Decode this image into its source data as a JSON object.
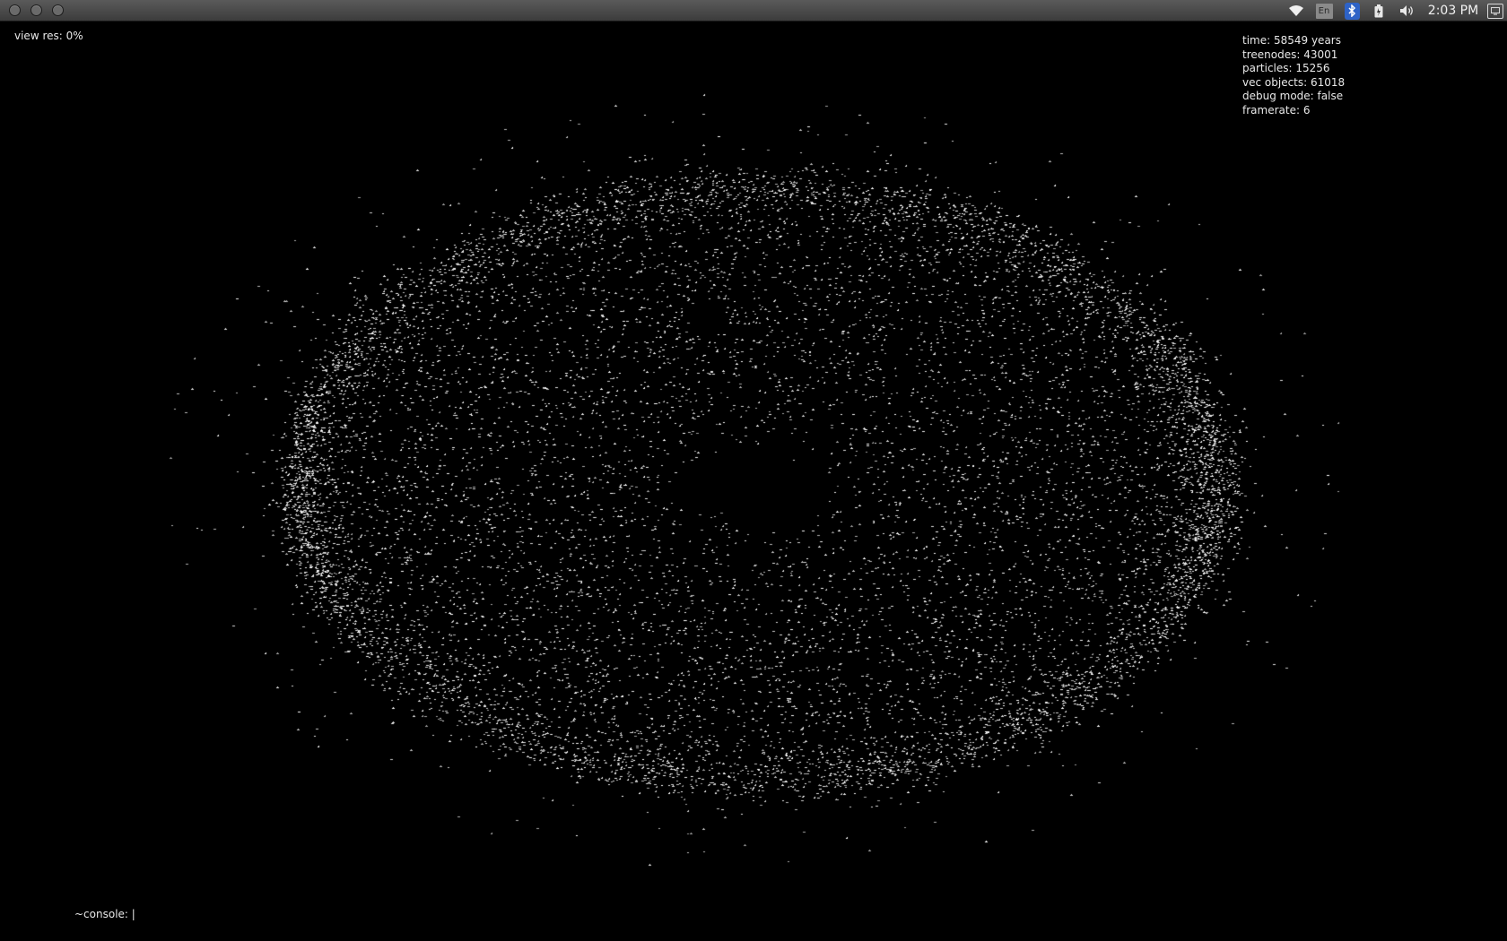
{
  "system_bar": {
    "window_controls": [
      "close",
      "minimize",
      "maximize"
    ],
    "tray": {
      "wifi_icon": "wifi-icon",
      "language": "En",
      "bluetooth_icon": "bluetooth-icon",
      "battery_icon": "battery-icon",
      "volume_icon": "speaker-icon",
      "clock": "2:03 PM",
      "session_icon": "session-menu-icon"
    }
  },
  "hud": {
    "view_res": "view res: 0%",
    "stats": {
      "time": "time: 58549 years",
      "treenodes": "treenodes: 43001",
      "particles": "particles: 15256",
      "vec_objects": "vec objects: 61018",
      "debug_mode": "debug mode: false",
      "framerate": "framerate: 6"
    }
  },
  "simulation": {
    "particle_color": "#ffffff",
    "background_color": "#000000"
  },
  "console": {
    "prompt": "~console: |"
  }
}
